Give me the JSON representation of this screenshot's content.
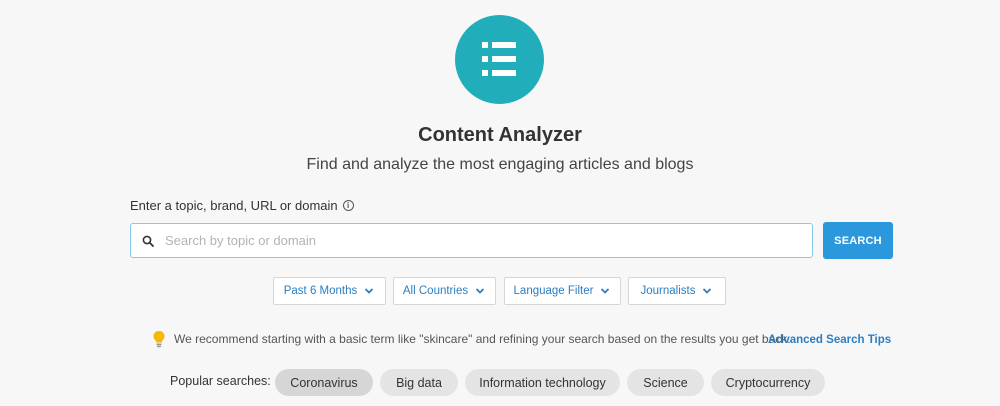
{
  "header": {
    "logo_icon": "list-icon",
    "title": "Content Analyzer",
    "subtitle": "Find and analyze the most engaging articles and blogs"
  },
  "search": {
    "label": "Enter a topic, brand, URL or domain",
    "info_icon": "info-icon",
    "placeholder": "Search by topic or domain",
    "value": "",
    "button_label": "SEARCH"
  },
  "filters": [
    {
      "label": "Past 6 Months"
    },
    {
      "label": "All Countries"
    },
    {
      "label": "Language Filter"
    },
    {
      "label": "Journalists"
    }
  ],
  "tip": {
    "icon": "lightbulb-icon",
    "text": "We recommend starting with a basic term like \"skincare\" and refining your search based on the results you get back.",
    "link_label": "Advanced Search Tips"
  },
  "popular": {
    "label": "Popular searches:",
    "items": [
      "Coronavirus",
      "Big data",
      "Information technology",
      "Science",
      "Cryptocurrency"
    ]
  },
  "colors": {
    "brand_teal": "#22adbb",
    "primary_blue": "#2b97dc",
    "link_blue": "#2b7ec1",
    "bulb_yellow": "#f5b800"
  }
}
